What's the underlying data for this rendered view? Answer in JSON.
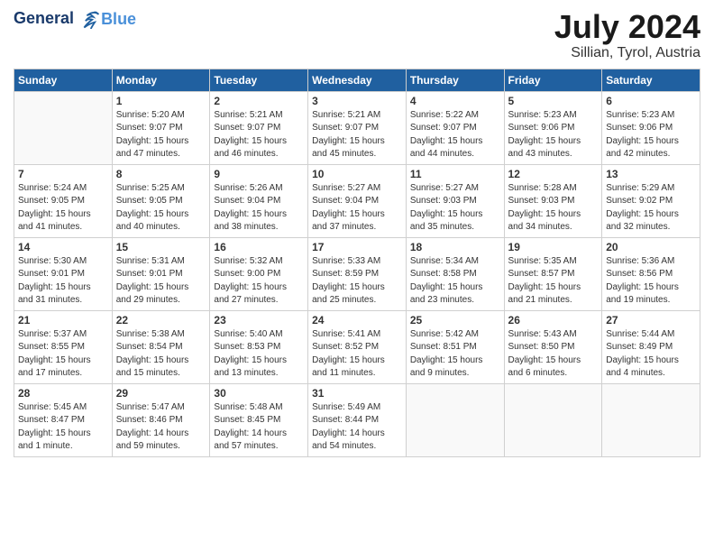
{
  "header": {
    "logo_line1": "General",
    "logo_line2": "Blue",
    "title": "July 2024",
    "location": "Sillian, Tyrol, Austria"
  },
  "weekdays": [
    "Sunday",
    "Monday",
    "Tuesday",
    "Wednesday",
    "Thursday",
    "Friday",
    "Saturday"
  ],
  "weeks": [
    [
      {
        "day": "",
        "info": ""
      },
      {
        "day": "1",
        "info": "Sunrise: 5:20 AM\nSunset: 9:07 PM\nDaylight: 15 hours\nand 47 minutes."
      },
      {
        "day": "2",
        "info": "Sunrise: 5:21 AM\nSunset: 9:07 PM\nDaylight: 15 hours\nand 46 minutes."
      },
      {
        "day": "3",
        "info": "Sunrise: 5:21 AM\nSunset: 9:07 PM\nDaylight: 15 hours\nand 45 minutes."
      },
      {
        "day": "4",
        "info": "Sunrise: 5:22 AM\nSunset: 9:07 PM\nDaylight: 15 hours\nand 44 minutes."
      },
      {
        "day": "5",
        "info": "Sunrise: 5:23 AM\nSunset: 9:06 PM\nDaylight: 15 hours\nand 43 minutes."
      },
      {
        "day": "6",
        "info": "Sunrise: 5:23 AM\nSunset: 9:06 PM\nDaylight: 15 hours\nand 42 minutes."
      }
    ],
    [
      {
        "day": "7",
        "info": "Sunrise: 5:24 AM\nSunset: 9:05 PM\nDaylight: 15 hours\nand 41 minutes."
      },
      {
        "day": "8",
        "info": "Sunrise: 5:25 AM\nSunset: 9:05 PM\nDaylight: 15 hours\nand 40 minutes."
      },
      {
        "day": "9",
        "info": "Sunrise: 5:26 AM\nSunset: 9:04 PM\nDaylight: 15 hours\nand 38 minutes."
      },
      {
        "day": "10",
        "info": "Sunrise: 5:27 AM\nSunset: 9:04 PM\nDaylight: 15 hours\nand 37 minutes."
      },
      {
        "day": "11",
        "info": "Sunrise: 5:27 AM\nSunset: 9:03 PM\nDaylight: 15 hours\nand 35 minutes."
      },
      {
        "day": "12",
        "info": "Sunrise: 5:28 AM\nSunset: 9:03 PM\nDaylight: 15 hours\nand 34 minutes."
      },
      {
        "day": "13",
        "info": "Sunrise: 5:29 AM\nSunset: 9:02 PM\nDaylight: 15 hours\nand 32 minutes."
      }
    ],
    [
      {
        "day": "14",
        "info": "Sunrise: 5:30 AM\nSunset: 9:01 PM\nDaylight: 15 hours\nand 31 minutes."
      },
      {
        "day": "15",
        "info": "Sunrise: 5:31 AM\nSunset: 9:01 PM\nDaylight: 15 hours\nand 29 minutes."
      },
      {
        "day": "16",
        "info": "Sunrise: 5:32 AM\nSunset: 9:00 PM\nDaylight: 15 hours\nand 27 minutes."
      },
      {
        "day": "17",
        "info": "Sunrise: 5:33 AM\nSunset: 8:59 PM\nDaylight: 15 hours\nand 25 minutes."
      },
      {
        "day": "18",
        "info": "Sunrise: 5:34 AM\nSunset: 8:58 PM\nDaylight: 15 hours\nand 23 minutes."
      },
      {
        "day": "19",
        "info": "Sunrise: 5:35 AM\nSunset: 8:57 PM\nDaylight: 15 hours\nand 21 minutes."
      },
      {
        "day": "20",
        "info": "Sunrise: 5:36 AM\nSunset: 8:56 PM\nDaylight: 15 hours\nand 19 minutes."
      }
    ],
    [
      {
        "day": "21",
        "info": "Sunrise: 5:37 AM\nSunset: 8:55 PM\nDaylight: 15 hours\nand 17 minutes."
      },
      {
        "day": "22",
        "info": "Sunrise: 5:38 AM\nSunset: 8:54 PM\nDaylight: 15 hours\nand 15 minutes."
      },
      {
        "day": "23",
        "info": "Sunrise: 5:40 AM\nSunset: 8:53 PM\nDaylight: 15 hours\nand 13 minutes."
      },
      {
        "day": "24",
        "info": "Sunrise: 5:41 AM\nSunset: 8:52 PM\nDaylight: 15 hours\nand 11 minutes."
      },
      {
        "day": "25",
        "info": "Sunrise: 5:42 AM\nSunset: 8:51 PM\nDaylight: 15 hours\nand 9 minutes."
      },
      {
        "day": "26",
        "info": "Sunrise: 5:43 AM\nSunset: 8:50 PM\nDaylight: 15 hours\nand 6 minutes."
      },
      {
        "day": "27",
        "info": "Sunrise: 5:44 AM\nSunset: 8:49 PM\nDaylight: 15 hours\nand 4 minutes."
      }
    ],
    [
      {
        "day": "28",
        "info": "Sunrise: 5:45 AM\nSunset: 8:47 PM\nDaylight: 15 hours\nand 1 minute."
      },
      {
        "day": "29",
        "info": "Sunrise: 5:47 AM\nSunset: 8:46 PM\nDaylight: 14 hours\nand 59 minutes."
      },
      {
        "day": "30",
        "info": "Sunrise: 5:48 AM\nSunset: 8:45 PM\nDaylight: 14 hours\nand 57 minutes."
      },
      {
        "day": "31",
        "info": "Sunrise: 5:49 AM\nSunset: 8:44 PM\nDaylight: 14 hours\nand 54 minutes."
      },
      {
        "day": "",
        "info": ""
      },
      {
        "day": "",
        "info": ""
      },
      {
        "day": "",
        "info": ""
      }
    ]
  ]
}
